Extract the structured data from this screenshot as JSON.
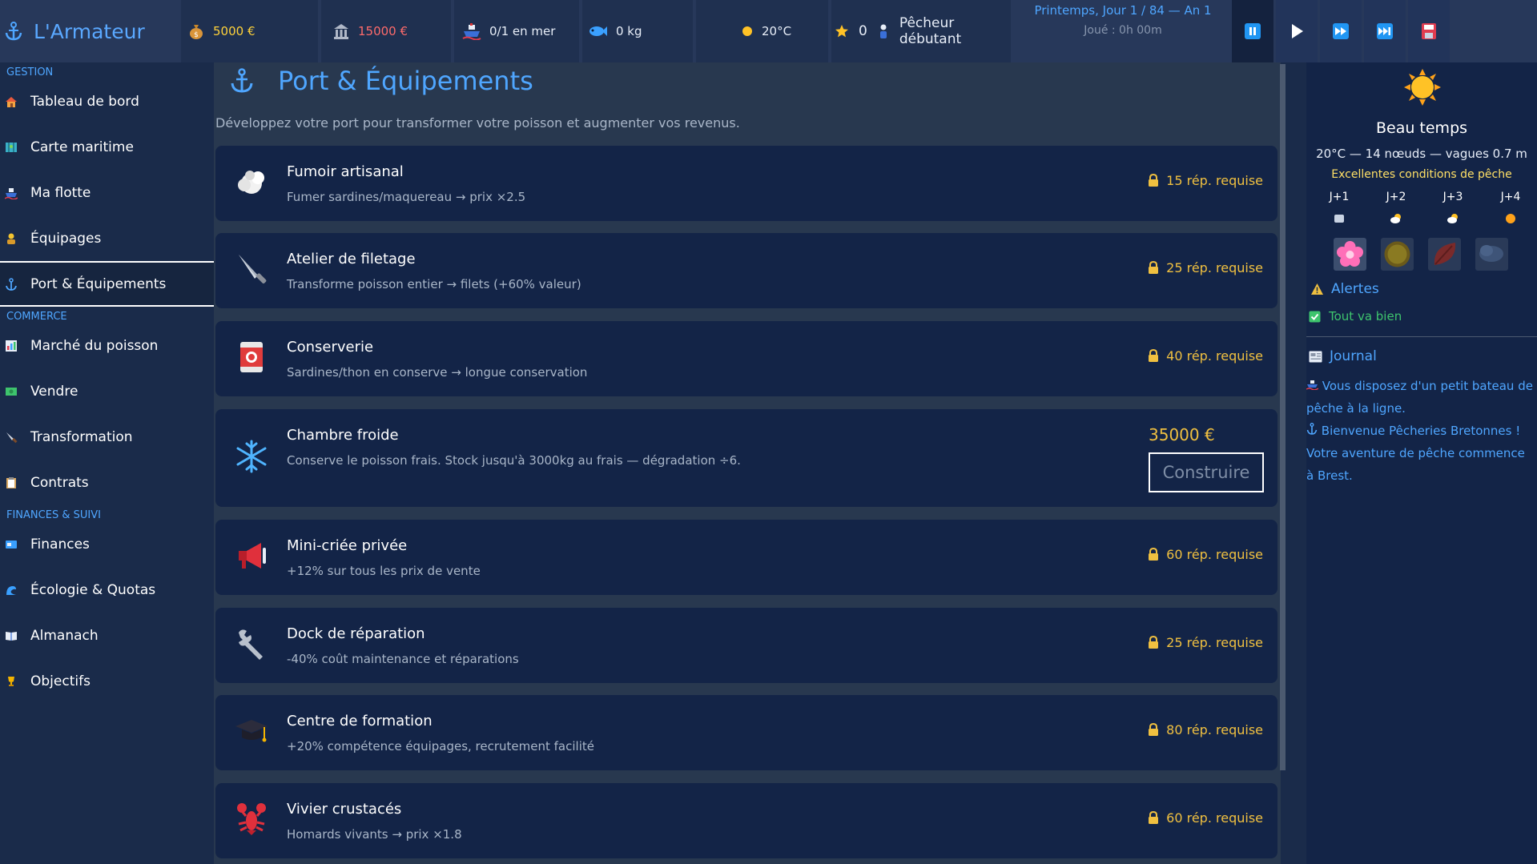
{
  "app": {
    "title": "L'Armateur"
  },
  "stats": {
    "money": "5000 €",
    "debt": "15000 €",
    "boats": "0/1 en mer",
    "fish": "0 kg",
    "temp": "20°C",
    "reputation": "0",
    "rank": "Pêcheur débutant"
  },
  "date": {
    "line1": "Printemps, Jour 1 / 84 — An 1",
    "line2": "Joué : 0h 00m"
  },
  "sidebar": {
    "sections": [
      "GESTION",
      "COMMERCE",
      "FINANCES & SUIVI"
    ],
    "gestion": [
      {
        "label": "Tableau de bord",
        "icon": "house-icon"
      },
      {
        "label": "Carte maritime",
        "icon": "map-icon"
      },
      {
        "label": "Ma flotte",
        "icon": "ship-icon"
      },
      {
        "label": "Équipages",
        "icon": "person-icon"
      },
      {
        "label": "Port & Équipements",
        "icon": "anchor-icon"
      }
    ],
    "commerce": [
      {
        "label": "Marché du poisson",
        "icon": "chart-icon"
      },
      {
        "label": "Vendre",
        "icon": "cash-icon"
      },
      {
        "label": "Transformation",
        "icon": "knife-icon"
      },
      {
        "label": "Contrats",
        "icon": "clipboard-icon"
      }
    ],
    "finances": [
      {
        "label": "Finances",
        "icon": "card-icon"
      },
      {
        "label": "Écologie & Quotas",
        "icon": "wave-icon"
      },
      {
        "label": "Almanach",
        "icon": "book-icon"
      },
      {
        "label": "Objectifs",
        "icon": "trophy-icon"
      }
    ]
  },
  "page": {
    "title": "Port & Équipements",
    "subtitle": "Développez votre port pour transformer votre poisson et augmenter vos revenus."
  },
  "equipment": [
    {
      "name": "Fumoir artisanal",
      "desc": "Fumer sardines/maquereau → prix ×2.5",
      "req": "15 rép. requise",
      "icon": "smoke-icon"
    },
    {
      "name": "Atelier de filetage",
      "desc": "Transforme poisson entier → filets (+60% valeur)",
      "req": "25 rép. requise",
      "icon": "knife-icon"
    },
    {
      "name": "Conserverie",
      "desc": "Sardines/thon en conserve → longue conservation",
      "req": "40 rép. requise",
      "icon": "can-icon"
    },
    {
      "name": "Chambre froide",
      "desc": "Conserve le poisson frais. Stock jusqu'à 3000kg au frais — dégradation ÷6.",
      "price": "35000 €",
      "button": "Construire",
      "icon": "snowflake-icon"
    },
    {
      "name": "Mini-criée privée",
      "desc": "+12% sur tous les prix de vente",
      "req": "60 rép. requise",
      "icon": "megaphone-icon"
    },
    {
      "name": "Dock de réparation",
      "desc": "-40% coût maintenance et réparations",
      "req": "25 rép. requise",
      "icon": "wrench-icon"
    },
    {
      "name": "Centre de formation",
      "desc": "+20% compétence équipages, recrutement facilité",
      "req": "80 rép. requise",
      "icon": "graduation-cap-icon"
    },
    {
      "name": "Vivier crustacés",
      "desc": "Homards vivants → prix ×1.8",
      "req": "60 rép. requise",
      "icon": "lobster-icon"
    }
  ],
  "weather": {
    "title": "Beau temps",
    "line": "20°C — 14 nœuds — vagues 0.7 m",
    "condition": "Excellentes conditions de pêche",
    "forecast": [
      {
        "day": "J+1",
        "icon": "cloud-icon"
      },
      {
        "day": "J+2",
        "icon": "sun-cloud-icon"
      },
      {
        "day": "J+3",
        "icon": "sun-cloud-icon"
      },
      {
        "day": "J+4",
        "icon": "sun-icon"
      }
    ],
    "seasons": [
      "spring-flower-icon",
      "summer-sun-icon",
      "autumn-leaf-icon",
      "winter-cloud-icon"
    ]
  },
  "alerts": {
    "title": "Alertes",
    "ok": "Tout va bien"
  },
  "journal": {
    "title": "Journal",
    "entries": [
      "Vous disposez d'un petit bateau de pêche à la ligne.",
      "Bienvenue Pêcheries Bretonnes ! Votre aventure de pêche commence à Brest."
    ]
  },
  "colors": {
    "accent": "#4fa6ff",
    "gold": "#f0c040",
    "bg": "#1a2b4a",
    "card": "#132447"
  }
}
